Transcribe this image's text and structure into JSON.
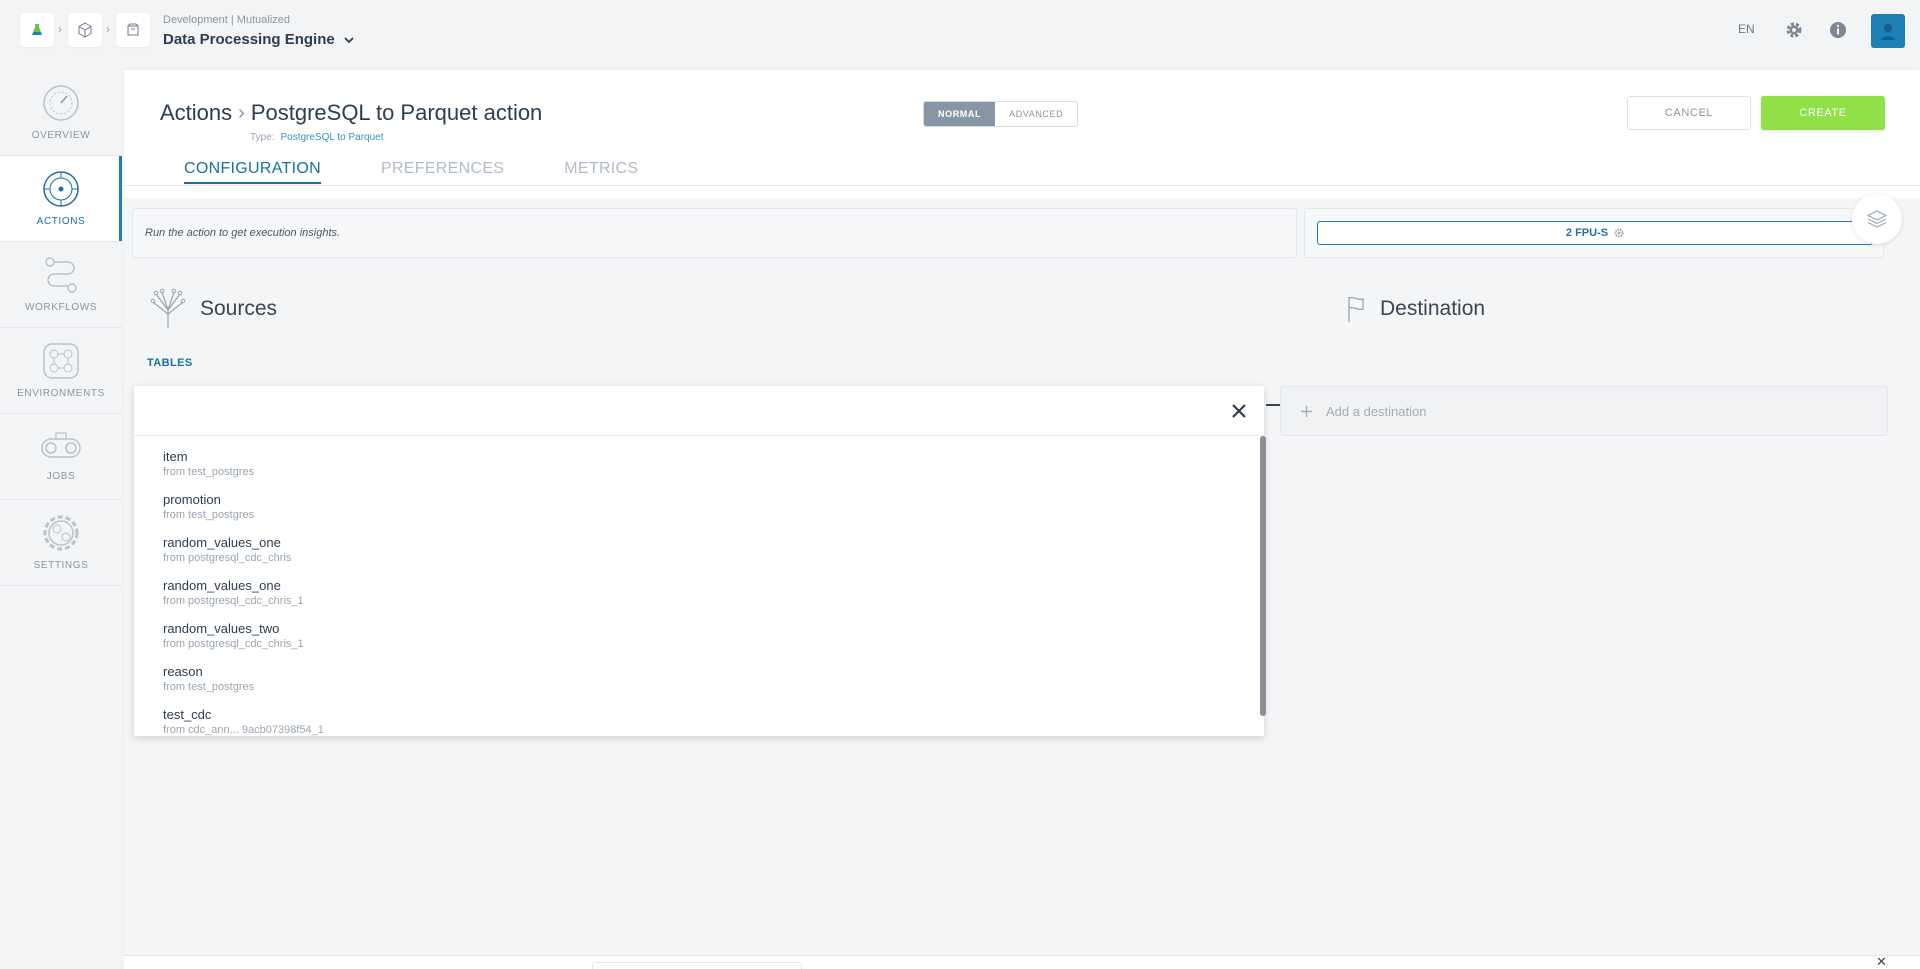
{
  "topbar": {
    "context_sub": "Development | Mutualized",
    "context_title": "Data Processing Engine",
    "lang": "EN",
    "icons": [
      "home-icon",
      "cube-icon",
      "package-icon",
      "gear-icon",
      "info-icon",
      "user-icon"
    ]
  },
  "sidebar": {
    "items": [
      {
        "label": "OVERVIEW",
        "icon": "gauge-icon",
        "active": false
      },
      {
        "label": "ACTIONS",
        "icon": "compass-icon",
        "active": true
      },
      {
        "label": "WORKFLOWS",
        "icon": "workflow-icon",
        "active": false
      },
      {
        "label": "ENVIRONMENTS",
        "icon": "network-icon",
        "active": false
      },
      {
        "label": "JOBS",
        "icon": "conveyor-icon",
        "active": false
      },
      {
        "label": "SETTINGS",
        "icon": "cog-icon",
        "active": false
      }
    ]
  },
  "header": {
    "breadcrumb_root": "Actions",
    "breadcrumb_current": "PostgreSQL to Parquet action",
    "type_label": "Type:",
    "type_value": "PostgreSQL to Parquet",
    "mode_normal": "NORMAL",
    "mode_advanced": "ADVANCED",
    "cancel_label": "CANCEL",
    "create_label": "CREATE"
  },
  "tabs": [
    "CONFIGURATION",
    "PREFERENCES",
    "METRICS"
  ],
  "insights_text": "Run the action to get execution insights.",
  "fpu_label": "2 FPU-S",
  "sources": {
    "title": "Sources",
    "tables_label": "TABLES",
    "items": [
      {
        "name": "item",
        "from": "from test_postgres"
      },
      {
        "name": "promotion",
        "from": "from test_postgres"
      },
      {
        "name": "random_values_one",
        "from": "from postgresql_cdc_chris"
      },
      {
        "name": "random_values_one",
        "from": "from postgresql_cdc_chris_1"
      },
      {
        "name": "random_values_two",
        "from": "from postgresql_cdc_chris_1"
      },
      {
        "name": "reason",
        "from": "from test_postgres"
      },
      {
        "name": "test_cdc",
        "from": "from cdc_ann... 9acb07398f54_1"
      }
    ]
  },
  "destination": {
    "title": "Destination",
    "add_label": "Add a destination"
  },
  "colors": {
    "accent": "#1c7fb6",
    "create": "#91e04a",
    "mode_active": "#8795a5"
  }
}
